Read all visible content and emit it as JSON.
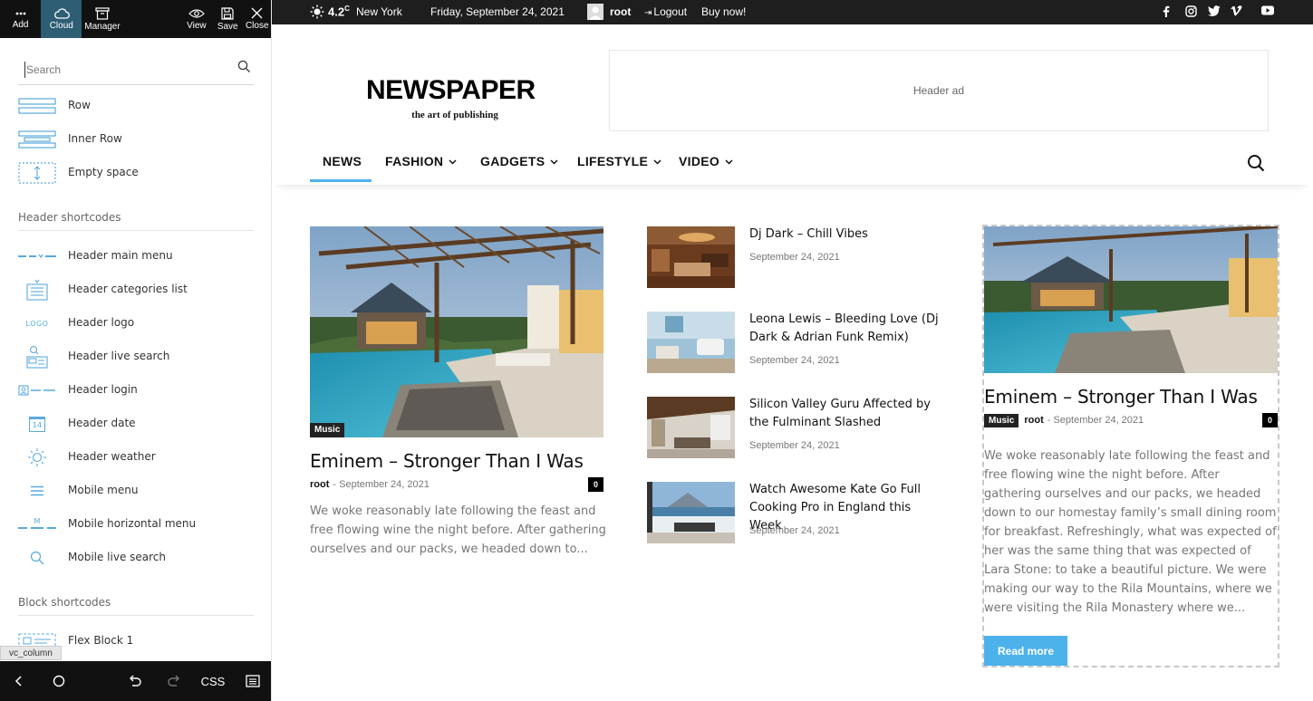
{
  "panel": {
    "toolbar": {
      "add": "Add",
      "cloud": "Cloud",
      "manager": "Manager",
      "view": "View",
      "save": "Save",
      "close": "Close"
    },
    "search_placeholder": "Search",
    "basic_items": [
      {
        "label": "Row",
        "icon": "row-icon"
      },
      {
        "label": "Inner Row",
        "icon": "inner-row-icon"
      },
      {
        "label": "Empty space",
        "icon": "empty-space-icon"
      }
    ],
    "header_section": "Header shortcodes",
    "header_items": [
      {
        "label": "Header main menu",
        "icon": "main-menu-icon"
      },
      {
        "label": "Header categories list",
        "icon": "categories-list-icon"
      },
      {
        "label": "Header logo",
        "icon": "logo-icon",
        "icon_text": "LOGO"
      },
      {
        "label": "Header live search",
        "icon": "live-search-icon"
      },
      {
        "label": "Header login",
        "icon": "login-icon"
      },
      {
        "label": "Header date",
        "icon": "date-icon",
        "icon_text": "14"
      },
      {
        "label": "Header weather",
        "icon": "weather-icon"
      },
      {
        "label": "Mobile menu",
        "icon": "hamburger-icon"
      },
      {
        "label": "Mobile horizontal menu",
        "icon": "horizontal-menu-icon",
        "icon_text": "M"
      },
      {
        "label": "Mobile live search",
        "icon": "magnifier-icon"
      }
    ],
    "block_section": "Block shortcodes",
    "block_items": [
      {
        "label": "Flex Block 1",
        "icon": "flex-block-icon"
      }
    ],
    "element_tag": "vc_column",
    "bottom_css": "CSS"
  },
  "topbar": {
    "temp": "4.2",
    "temp_unit": "C",
    "city": "New York",
    "date": "Friday, September 24, 2021",
    "user": "root",
    "logout": "Logout",
    "buy": "Buy now!"
  },
  "header": {
    "logo": "NEWSPAPER",
    "tagline": "the art of publishing",
    "ad": "Header ad"
  },
  "nav": [
    {
      "label": "NEWS",
      "dropdown": false
    },
    {
      "label": "FASHION",
      "dropdown": true
    },
    {
      "label": "GADGETS",
      "dropdown": true
    },
    {
      "label": "LIFESTYLE",
      "dropdown": true
    },
    {
      "label": "VIDEO",
      "dropdown": true
    }
  ],
  "main": {
    "category": "Music",
    "title": "Eminem – Stronger Than I Was",
    "author": "root",
    "sep": "-",
    "date": "September 24, 2021",
    "comments": "0",
    "excerpt": "We woke reasonably late following the feast and free flowing wine the night before. After gathering ourselves and our packs, we headed down to..."
  },
  "list": [
    {
      "title": "Dj Dark – Chill Vibes",
      "date": "September 24, 2021"
    },
    {
      "title": "Leona Lewis – Bleeding Love (Dj Dark & Adrian Funk Remix)",
      "date": "September 24, 2021"
    },
    {
      "title": "Silicon Valley Guru Affected by the Fulminant Slashed",
      "date": "September 24, 2021"
    },
    {
      "title": "Watch Awesome Kate Go Full Cooking Pro in England this Week",
      "date": "September 24, 2021"
    }
  ],
  "side": {
    "title": "Eminem – Stronger Than I Was",
    "category": "Music",
    "author": "root",
    "sep": "-",
    "date": "September 24, 2021",
    "comments": "0",
    "excerpt": "We woke reasonably late following the feast and free flowing wine the night before. After gathering ourselves and our packs, we headed down to our homestay family’s small dining room for breakfast. Refreshingly, what was expected of her was the same thing that was expected of Lara Stone: to take a beautiful picture. We were making our way to the Rila Mountains, where we were visiting the Rila Monastery where we...",
    "read_more": "Read more"
  },
  "colors": {
    "accent": "#4db2ec",
    "topbar": "#1e1e1e",
    "panel_toolbar": "#111111",
    "panel_active": "#2d5e74"
  }
}
